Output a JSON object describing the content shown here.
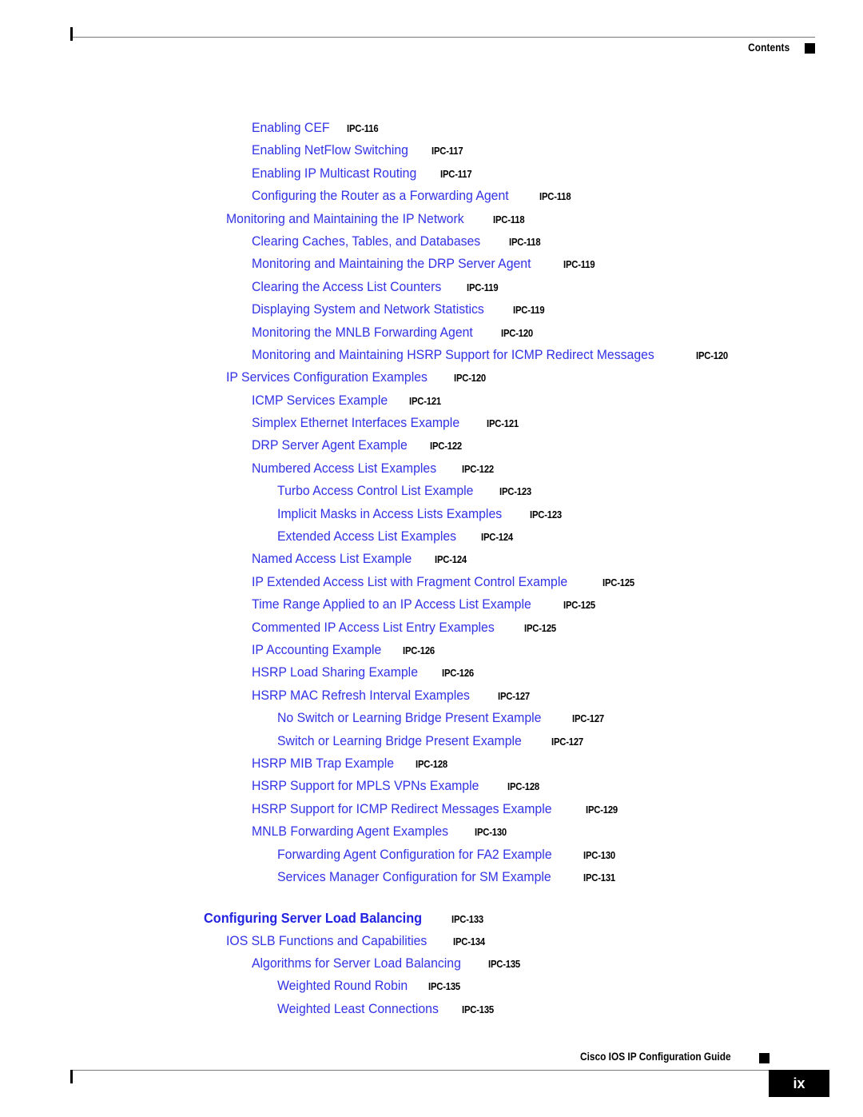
{
  "header": {
    "label": "Contents",
    "marker_icon": "black-square-marker"
  },
  "footer": {
    "guide_title": "Cisco IOS IP Configuration Guide",
    "marker_icon": "black-square-marker",
    "page_number": "ix"
  },
  "toc": {
    "entries": [
      {
        "level": 2,
        "title": "Enabling CEF",
        "page": "IPC-116"
      },
      {
        "level": 2,
        "title": "Enabling NetFlow Switching",
        "page": "IPC-117"
      },
      {
        "level": 2,
        "title": "Enabling IP Multicast Routing",
        "page": "IPC-117"
      },
      {
        "level": 2,
        "title": "Configuring the Router as a Forwarding Agent",
        "page": "IPC-118"
      },
      {
        "level": 1,
        "title": "Monitoring and Maintaining the IP Network",
        "page": "IPC-118"
      },
      {
        "level": 2,
        "title": "Clearing Caches, Tables, and Databases",
        "page": "IPC-118"
      },
      {
        "level": 2,
        "title": "Monitoring and Maintaining the DRP Server Agent",
        "page": "IPC-119"
      },
      {
        "level": 2,
        "title": "Clearing the Access List Counters",
        "page": "IPC-119"
      },
      {
        "level": 2,
        "title": "Displaying System and Network Statistics",
        "page": "IPC-119"
      },
      {
        "level": 2,
        "title": "Monitoring the MNLB Forwarding Agent",
        "page": "IPC-120"
      },
      {
        "level": 2,
        "title": "Monitoring and Maintaining HSRP Support for ICMP Redirect Messages",
        "page": "IPC-120"
      },
      {
        "level": 1,
        "title": "IP Services Configuration Examples",
        "page": "IPC-120"
      },
      {
        "level": 2,
        "title": "ICMP Services Example",
        "page": "IPC-121"
      },
      {
        "level": 2,
        "title": "Simplex Ethernet Interfaces Example",
        "page": "IPC-121"
      },
      {
        "level": 2,
        "title": "DRP Server Agent Example",
        "page": "IPC-122"
      },
      {
        "level": 2,
        "title": "Numbered Access List Examples",
        "page": "IPC-122"
      },
      {
        "level": 3,
        "title": "Turbo Access Control List Example",
        "page": "IPC-123"
      },
      {
        "level": 3,
        "title": "Implicit Masks in Access Lists Examples",
        "page": "IPC-123"
      },
      {
        "level": 3,
        "title": "Extended Access List Examples",
        "page": "IPC-124"
      },
      {
        "level": 2,
        "title": "Named Access List Example",
        "page": "IPC-124"
      },
      {
        "level": 2,
        "title": "IP Extended Access List with Fragment Control Example",
        "page": "IPC-125"
      },
      {
        "level": 2,
        "title": "Time Range Applied to an IP Access List Example",
        "page": "IPC-125"
      },
      {
        "level": 2,
        "title": "Commented IP Access List Entry Examples",
        "page": "IPC-125"
      },
      {
        "level": 2,
        "title": "IP Accounting Example",
        "page": "IPC-126"
      },
      {
        "level": 2,
        "title": "HSRP Load Sharing Example",
        "page": "IPC-126"
      },
      {
        "level": 2,
        "title": "HSRP MAC Refresh Interval Examples",
        "page": "IPC-127"
      },
      {
        "level": 3,
        "title": "No Switch or Learning Bridge Present Example",
        "page": "IPC-127"
      },
      {
        "level": 3,
        "title": "Switch or Learning Bridge Present Example",
        "page": "IPC-127"
      },
      {
        "level": 2,
        "title": "HSRP MIB Trap Example",
        "page": "IPC-128"
      },
      {
        "level": 2,
        "title": "HSRP Support for MPLS VPNs Example",
        "page": "IPC-128"
      },
      {
        "level": 2,
        "title": "HSRP Support for ICMP Redirect Messages Example",
        "page": "IPC-129"
      },
      {
        "level": 2,
        "title": "MNLB Forwarding Agent Examples",
        "page": "IPC-130"
      },
      {
        "level": 3,
        "title": "Forwarding Agent Configuration for FA2 Example",
        "page": "IPC-130"
      },
      {
        "level": 3,
        "title": "Services Manager Configuration for SM Example",
        "page": "IPC-131"
      },
      {
        "level": 0,
        "title": "Configuring Server Load Balancing",
        "page": "IPC-133",
        "spacer_above": true
      },
      {
        "level": 1,
        "title": "IOS SLB Functions and Capabilities",
        "page": "IPC-134"
      },
      {
        "level": 2,
        "title": "Algorithms for Server Load Balancing",
        "page": "IPC-135"
      },
      {
        "level": 3,
        "title": "Weighted Round Robin",
        "page": "IPC-135"
      },
      {
        "level": 3,
        "title": "Weighted Least Connections",
        "page": "IPC-135"
      }
    ]
  },
  "colors": {
    "link_blue": "#3232e6",
    "chapter_blue": "#2222e0",
    "text_black": "#000000",
    "rule_gray": "#777777"
  }
}
